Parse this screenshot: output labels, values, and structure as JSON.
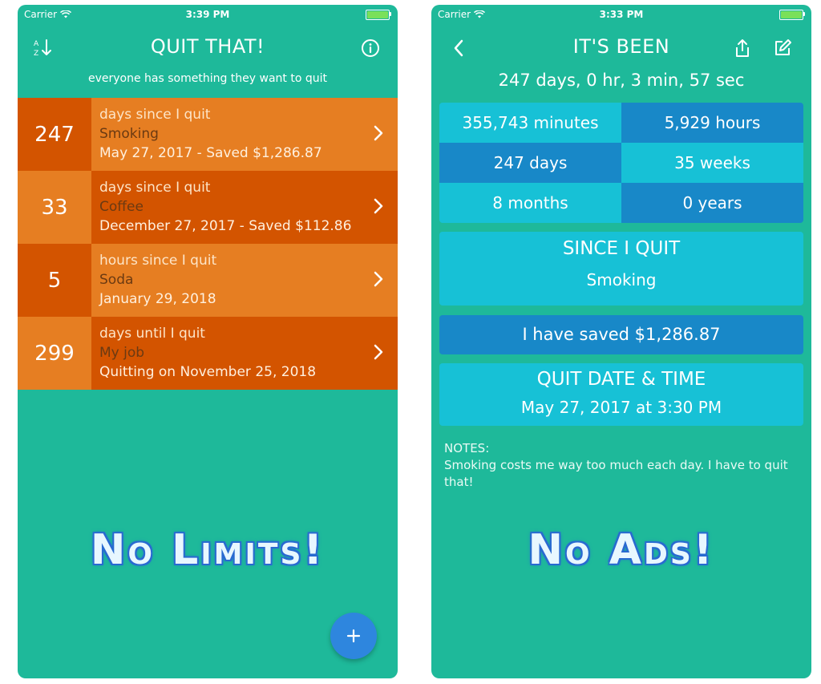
{
  "left": {
    "status": {
      "carrier": "Carrier",
      "time": "3:39 PM"
    },
    "nav": {
      "title": "QUIT THAT!"
    },
    "subtitle": "everyone has something they want to quit",
    "items": [
      {
        "count": "247",
        "label": "days since I quit",
        "name": "Smoking",
        "detail": "May 27, 2017 - Saved $1,286.87"
      },
      {
        "count": "33",
        "label": "days since I quit",
        "name": "Coffee",
        "detail": "December 27, 2017 - Saved $112.86"
      },
      {
        "count": "5",
        "label": "hours since I quit",
        "name": "Soda",
        "detail": "January 29, 2018"
      },
      {
        "count": "299",
        "label": "days until I quit",
        "name": "My job",
        "detail": "Quitting on November 25, 2018"
      }
    ],
    "promo": "No Limits!",
    "fab_label": "+"
  },
  "right": {
    "status": {
      "carrier": "Carrier",
      "time": "3:33 PM"
    },
    "nav": {
      "title": "IT'S BEEN"
    },
    "elapsed": "247 days, 0 hr, 3 min, 57 sec",
    "stats": {
      "minutes": "355,743 minutes",
      "hours": "5,929 hours",
      "days": "247 days",
      "weeks": "35 weeks",
      "months": "8 months",
      "years": "0 years"
    },
    "since": {
      "title": "SINCE I QUIT",
      "value": "Smoking"
    },
    "saved": "I have saved $1,286.87",
    "quit_date": {
      "title": "QUIT DATE & TIME",
      "value": "May 27, 2017 at 3:30 PM"
    },
    "notes": {
      "label": "NOTES:",
      "text": "Smoking costs me way too much each day. I have to quit that!"
    },
    "promo": "No Ads!"
  },
  "colors": {
    "background": "#1eb99a",
    "orange_dark": "#d35400",
    "orange_light": "#e67e22",
    "cyan": "#17c1d6",
    "blue": "#1888c8",
    "fab": "#2e86de"
  },
  "icons": [
    "wifi-icon",
    "battery-icon",
    "sort-az-icon",
    "info-icon",
    "chevron-right-icon",
    "back-chevron-icon",
    "share-icon",
    "edit-icon",
    "plus-icon"
  ]
}
